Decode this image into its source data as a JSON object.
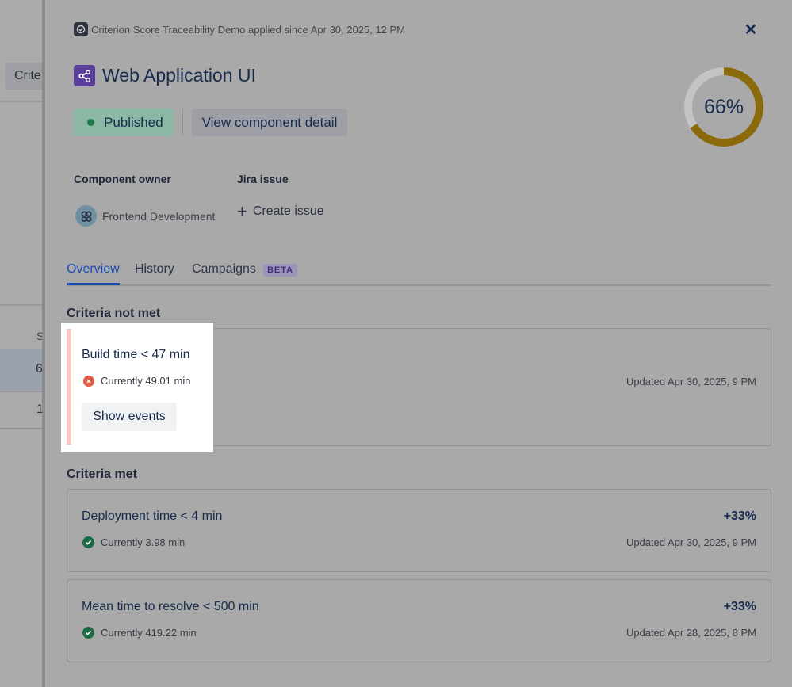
{
  "background": {
    "tab_label": "Crite",
    "column_header": "S",
    "row_values": [
      "6",
      "1"
    ]
  },
  "panel": {
    "applied_text": "Criterion Score Traceability Demo applied since Apr 30, 2025, 12 PM",
    "close_icon": "close-icon",
    "title": "Web Application UI",
    "status_label": "Published",
    "view_detail_label": "View component detail",
    "score": {
      "label": "66%",
      "value": 0.66,
      "color": "#8a6a0a",
      "track_color": "#c4c4c4"
    },
    "owner_heading": "Component owner",
    "owner_name": "Frontend Development",
    "jira_heading": "Jira issue",
    "create_issue_label": "Create issue",
    "tabs": [
      {
        "label": "Overview",
        "active": true
      },
      {
        "label": "History"
      },
      {
        "label": "Campaigns",
        "badge": "BETA"
      }
    ]
  },
  "criteria_not_met": {
    "heading": "Criteria not met",
    "items": [
      {
        "name": "Build time < 47 min",
        "status": "Currently 49.01 min",
        "updated": "Updated Apr 30, 2025, 9 PM",
        "action": "Show events"
      }
    ]
  },
  "criteria_met": {
    "heading": "Criteria met",
    "items": [
      {
        "name": "Deployment time < 4 min",
        "status": "Currently 3.98 min",
        "updated": "Updated Apr 30, 2025, 9 PM",
        "weight": "+33%"
      },
      {
        "name": "Mean time to resolve < 500 min",
        "status": "Currently 419.22 min",
        "updated": "Updated Apr 28, 2025, 8 PM",
        "weight": "+33%"
      }
    ]
  },
  "colors": {
    "accent": "#1a4db3",
    "success": "#1b6b43",
    "error": "#e35a44"
  }
}
